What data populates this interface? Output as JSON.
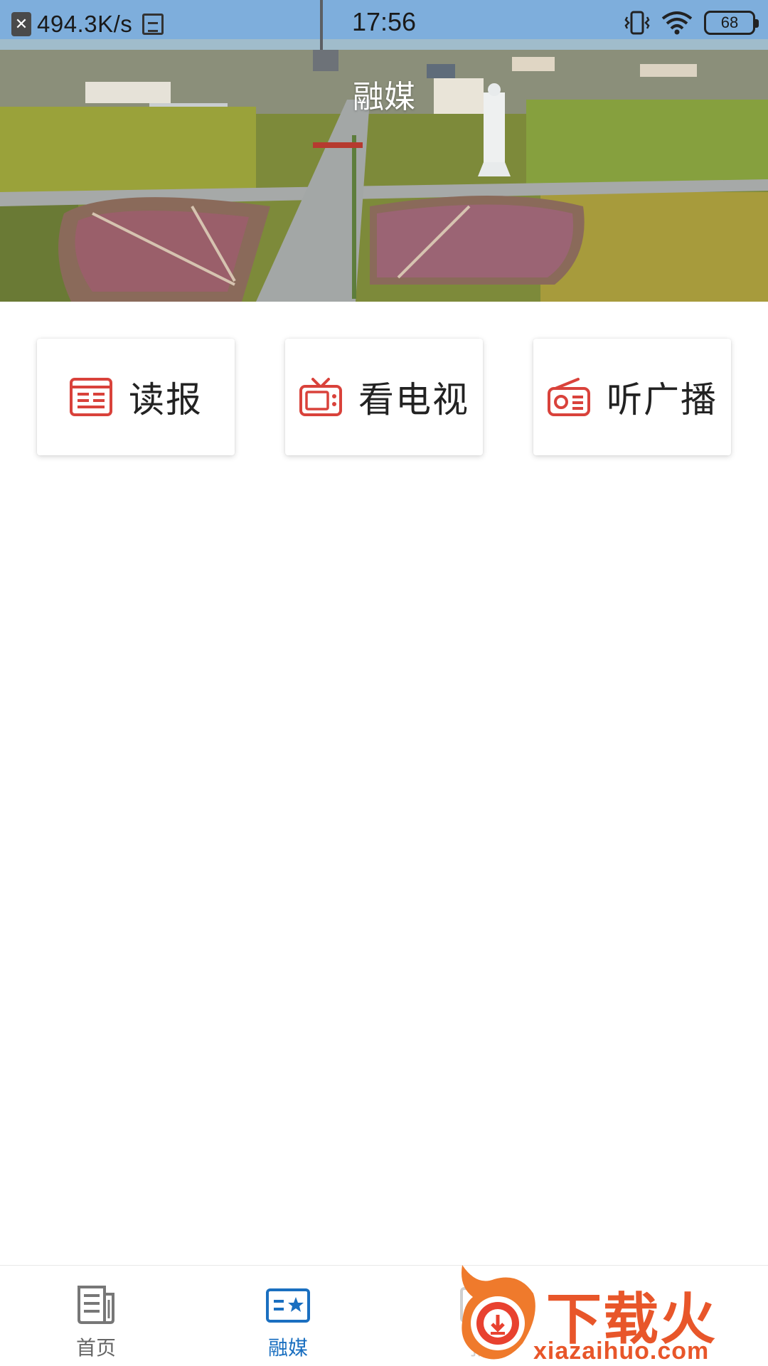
{
  "status_bar": {
    "network_speed": "494.3K/s",
    "time": "17:56",
    "battery_level": "68",
    "icons": [
      "close-box-icon",
      "image-icon",
      "vibrate-icon",
      "wifi-icon",
      "battery-icon"
    ]
  },
  "header": {
    "title": "融媒"
  },
  "cards": [
    {
      "label": "读报",
      "icon": "newspaper-icon"
    },
    {
      "label": "看电视",
      "icon": "tv-icon"
    },
    {
      "label": "听广播",
      "icon": "radio-icon"
    }
  ],
  "bottom_nav": {
    "items": [
      {
        "label": "首页",
        "icon": "article-icon",
        "active": false
      },
      {
        "label": "融媒",
        "icon": "media-card-icon",
        "active": true
      },
      {
        "label": "报",
        "icon": "report-icon",
        "active": false
      }
    ]
  },
  "watermark": {
    "text": "下载火",
    "url": "xiazaihuo.com",
    "icon": "download-flame-logo"
  },
  "colors": {
    "accent_red": "#d9423b",
    "active_blue": "#1a6fc0",
    "inactive_gray": "#666666",
    "watermark_orange": "#e8562a"
  }
}
